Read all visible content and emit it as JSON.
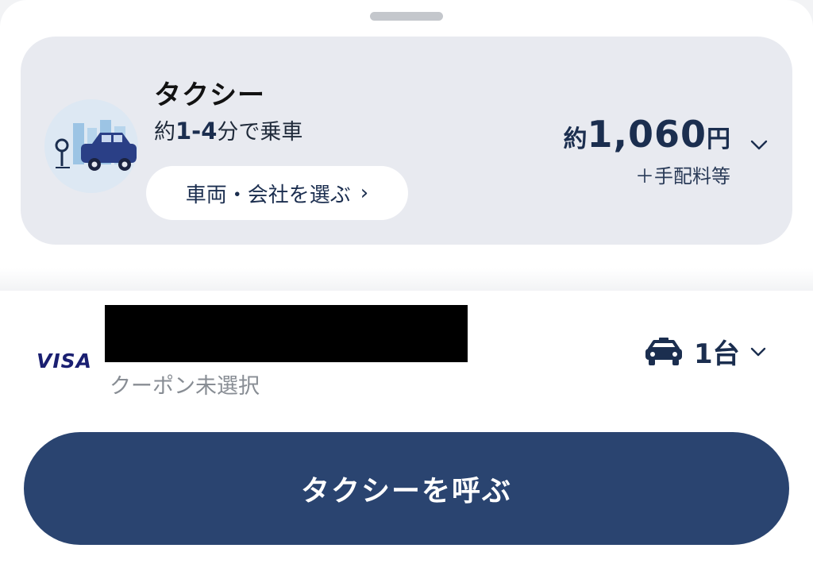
{
  "ride_option": {
    "title": "タクシー",
    "eta_prefix": "約",
    "eta_range": "1-4",
    "eta_suffix": "分で乗車",
    "choose_label": "車両・会社を選ぶ",
    "fare_prefix": "約",
    "fare_amount": "1,060",
    "fare_unit": "円",
    "fee_note": "＋手配料等"
  },
  "payment": {
    "card_brand": "VISA",
    "card_number_redacted": "",
    "coupon_text": "クーポン未選択"
  },
  "vehicle_count": {
    "value": "1台"
  },
  "call_button_label": "タクシーを呼ぶ",
  "colors": {
    "navy": "#1b2e4f",
    "button": "#2a4470",
    "card_bg": "#e8eaf0",
    "visa": "#1a1f71"
  },
  "icons": [
    "taxi-illustration",
    "chevron-right-icon",
    "chevron-down-icon",
    "taxi-icon"
  ]
}
